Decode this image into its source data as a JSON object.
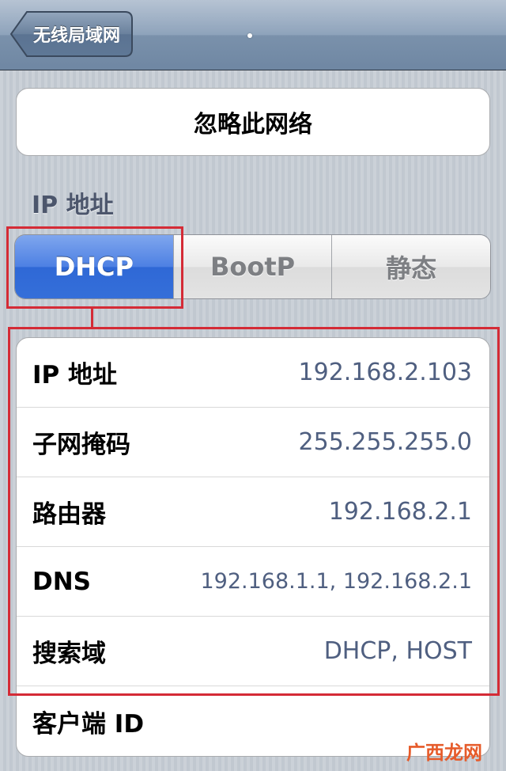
{
  "navbar": {
    "back_label": "无线局域网"
  },
  "forget_button": {
    "label": "忽略此网络"
  },
  "section": {
    "header": "IP 地址"
  },
  "segments": [
    {
      "label": "DHCP",
      "selected": true
    },
    {
      "label": "BootP",
      "selected": false
    },
    {
      "label": "静态",
      "selected": false
    }
  ],
  "rows": [
    {
      "label": "IP 地址",
      "value": "192.168.2.103"
    },
    {
      "label": "子网掩码",
      "value": "255.255.255.0"
    },
    {
      "label": "路由器",
      "value": "192.168.2.1"
    },
    {
      "label": "DNS",
      "value": "192.168.1.1, 192.168.2.1"
    },
    {
      "label": "搜索域",
      "value": "DHCP, HOST"
    },
    {
      "label": "客户端 ID",
      "value": ""
    }
  ],
  "watermark": {
    "text": "广西龙网"
  },
  "colors": {
    "accent": "#3a73dd",
    "highlight": "#d42b36",
    "value_text": "#4f5f80"
  }
}
